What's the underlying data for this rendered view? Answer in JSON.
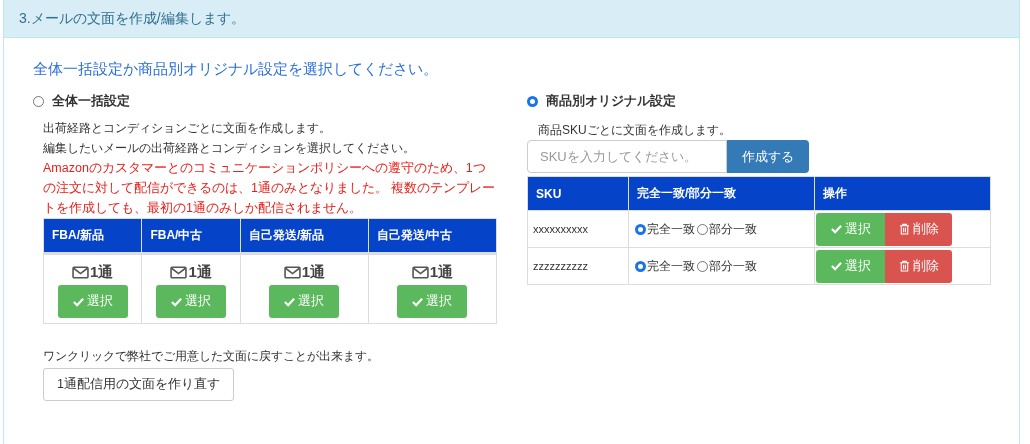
{
  "panel": {
    "title": "3.メールの文面を作成/編集します。"
  },
  "prompt": "全体一括設定か商品別オリジナル設定を選択してください。",
  "bulk": {
    "label": "全体一括設定",
    "selected": false,
    "description": [
      "出荷経路とコンディションごとに文面を作成します。",
      "編集したいメールの出荷経路とコンディションを選択してください。"
    ],
    "notice": "Amazonのカスタマーとのコミュニケーションポリシーへの遵守のため、1つの注文に対して配信ができるのは、1通のみとなりました。 複数のテンプレートを作成しても、最初の1通のみしか配信されません。",
    "columns": [
      "FBA/新品",
      "FBA/中古",
      "自己発送/新品",
      "自己発送/中古"
    ],
    "cells": [
      {
        "count": "1通",
        "button": "選択"
      },
      {
        "count": "1通",
        "button": "選択"
      },
      {
        "count": "1通",
        "button": "選択"
      },
      {
        "count": "1通",
        "button": "選択"
      }
    ],
    "reset_note": "ワンクリックで弊社でご用意した文面に戻すことが出来ます。",
    "reset_button": "1通配信用の文面を作り直す"
  },
  "sku": {
    "label": "商品別オリジナル設定",
    "selected": true,
    "description": "商品SKUごとに文面を作成します。",
    "input": {
      "placeholder": "SKUを入力してください。"
    },
    "create_button": "作成する",
    "columns": [
      "SKU",
      "完全一致/部分一致",
      "操作"
    ],
    "rows": [
      {
        "sku": "xxxxxxxxxx",
        "match": [
          {
            "label": "完全一致",
            "selected": true
          },
          {
            "label": "部分一致",
            "selected": false
          }
        ],
        "select_button": "選択",
        "delete_button": "削除"
      },
      {
        "sku": "zzzzzzzzzz",
        "match": [
          {
            "label": "完全一致",
            "selected": true
          },
          {
            "label": "部分一致",
            "selected": false
          }
        ],
        "select_button": "選択",
        "delete_button": "削除"
      }
    ]
  }
}
